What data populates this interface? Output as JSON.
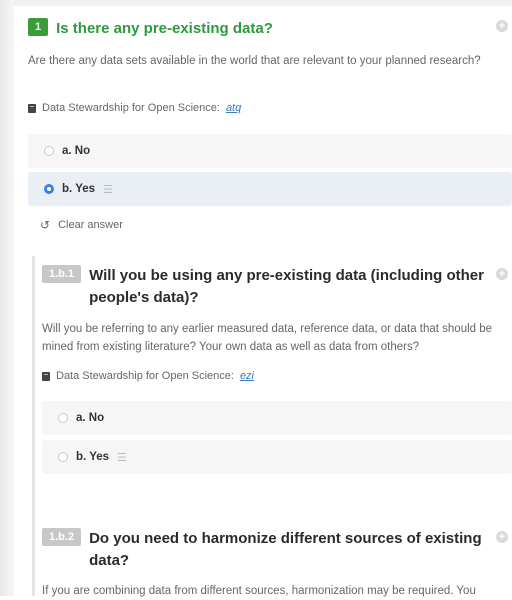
{
  "q1": {
    "number": "1",
    "title": "Is there any pre-existing data?",
    "description": "Are there any data sets available in the world that are relevant to your planned research?",
    "reference_label": "Data Stewardship for Open Science:",
    "reference_link": "atq",
    "options": [
      "a. No",
      "b. Yes"
    ],
    "selected": "b. Yes",
    "clear_label": "Clear answer"
  },
  "q1b1": {
    "number": "1.b.1",
    "title": "Will you be using any pre-existing data (including other people's data)?",
    "description": "Will you be referring to any earlier measured data, reference data, or data that should be mined from existing literature? Your own data as well as data from others?",
    "reference_label": "Data Stewardship for Open Science:",
    "reference_link": "ezi",
    "options": [
      "a. No",
      "b. Yes"
    ]
  },
  "q1b2": {
    "number": "1.b.2",
    "title": "Do you need to harmonize different sources of existing data?",
    "description": "If you are combining data from different sources, harmonization may be required. You"
  },
  "icons": {
    "plus": "plus-circle-icon",
    "book": "book-icon",
    "list": "list-icon",
    "undo": "undo-icon"
  },
  "colors": {
    "green": "#2d9a3d",
    "badge_grey": "#c7c7c7",
    "radio_selected": "#3b82e0",
    "link": "#3a78c2"
  }
}
